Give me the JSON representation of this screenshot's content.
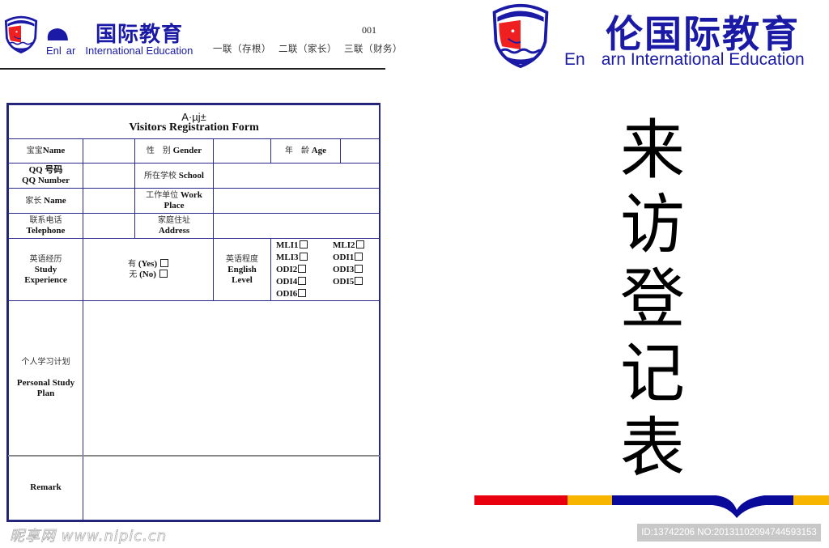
{
  "left_page": {
    "brand": {
      "cn": "国际教育",
      "en_part1": "Enl",
      "en_part2": "ar",
      "en_part3": "International Education"
    },
    "serial_number": "001",
    "copies": [
      "一联（存根）",
      "二联（家长）",
      "三联（财务）"
    ],
    "form": {
      "title_garbled": "A·µj±",
      "title": "Visitors Registration Form",
      "rows": {
        "baby_name_cn": "宝宝",
        "baby_name_en": "Name",
        "gender_cn": "性　别",
        "gender_en": "Gender",
        "age_cn": "年　龄",
        "age_en": "Age",
        "qq_cn": "QQ 号码",
        "qq_en": "QQ Number",
        "school_cn": "所在学校",
        "school_en": "School",
        "parent_cn": "家长",
        "parent_en": "Name",
        "work_cn": "工作单位",
        "work_en1": "Work",
        "work_en2": "Place",
        "phone_cn": "联系电话",
        "phone_en": "Telephone",
        "address_cn": "家庭住址",
        "address_en": "Address",
        "study_cn": "英语经历",
        "study_en1": "Study",
        "study_en2": "Experience",
        "yes_cn": "有",
        "yes_en": "(Yes)",
        "no_cn": "无",
        "no_en": "(No)",
        "level_cn": "英语程度",
        "level_en1": "English",
        "level_en2": "Level",
        "levels": [
          "MLI1",
          "MLI2",
          "MLI3",
          "ODI1",
          "ODI2",
          "ODI3",
          "ODI4",
          "ODI5",
          "ODI6"
        ],
        "plan_cn": "个人学习计划",
        "plan_en": "Personal Study Plan",
        "remark": "Remark"
      }
    },
    "watermark": "昵享网 www.nipic.cn"
  },
  "right_page": {
    "brand": {
      "cn": "伦国际教育",
      "en_part1": "En",
      "en_part2": "arn International Education"
    },
    "vertical_title": [
      "来",
      "访",
      "登",
      "记",
      "表"
    ],
    "bar_colors": {
      "red": "#e8000f",
      "yellow": "#f7b500",
      "blue": "#0a0a9a"
    },
    "id_tag": "ID:13742206 NO:20131102094744593153"
  },
  "colors": {
    "brand_blue": "#1a1aa6",
    "table_border": "#2a2a8a",
    "logo_red": "#f02020"
  }
}
